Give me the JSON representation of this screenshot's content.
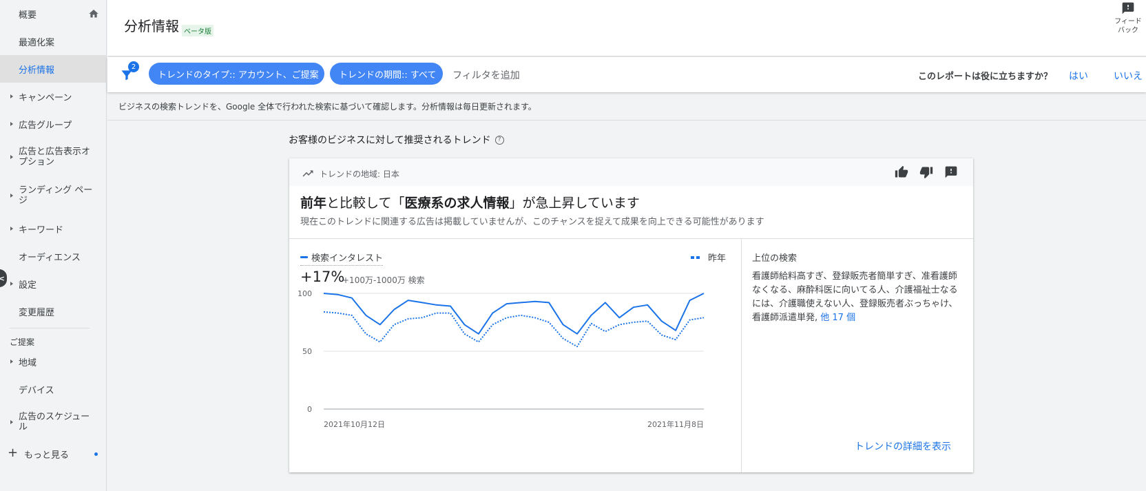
{
  "sidebar": {
    "items": [
      {
        "label": "概要",
        "caret": false
      },
      {
        "label": "最適化案",
        "caret": false
      },
      {
        "label": "分析情報",
        "caret": false,
        "active": true
      },
      {
        "label": "キャンペーン",
        "caret": true
      },
      {
        "label": "広告グループ",
        "caret": true
      },
      {
        "label": "広告と広告表示オプション",
        "caret": true
      },
      {
        "label": "ランディング ページ",
        "caret": true
      },
      {
        "label": "キーワード",
        "caret": true
      },
      {
        "label": "オーディエンス",
        "caret": false
      },
      {
        "label": "設定",
        "caret": true
      },
      {
        "label": "変更履歴",
        "caret": false
      }
    ],
    "section_label": "ご提案",
    "suggest_items": [
      {
        "label": "地域",
        "caret": true
      },
      {
        "label": "デバイス",
        "caret": false
      },
      {
        "label": "広告のスケジュール",
        "caret": true
      }
    ],
    "more_label": "もっと見る"
  },
  "header": {
    "title": "分析情報",
    "beta": "ベータ版",
    "feedback_label": "フィードバック"
  },
  "filterbar": {
    "filter_count": "2",
    "chip_type": "トレンドのタイプ:: アカウント、ご提案",
    "chip_period": "トレンドの期間:: すべて",
    "add_filter": "フィルタを追加",
    "question": "このレポートは役に立ちますか？",
    "yes": "はい",
    "no": "いいえ"
  },
  "info_text": "ビジネスの検索トレンドを、Google 全体で行われた検索に基づいて確認します。分析情報は毎日更新されます。",
  "section_title": "お客様のビジネスに対して推奨されるトレンド",
  "card": {
    "region": "トレンドの地域: 日本",
    "headline_pre": "前年",
    "headline_mid1": "と比較して「",
    "headline_bold": "医療系の求人情報",
    "headline_post": "」が急上昇しています",
    "subline": "現在このトレンドに関連する広告は掲載していませんが、このチャンスを捉えて成果を向上できる可能性があります",
    "legend_current": "検索インタレスト",
    "legend_prev": "昨年",
    "change_pct": "+17%",
    "change_sub": "+100万-1000万 検索",
    "top_searches_label": "上位の検索",
    "top_searches_text": "看護師給料高すぎ、登録販売者簡単すぎ、准看護師なくなる、麻酔科医に向いてる人、介護福祉士なるには、介護職使えない人、登録販売者ぶっちゃけ、看護師派遣単発, ",
    "more_link": "他 17 個",
    "detail_link": "トレンドの詳細を表示"
  },
  "chart_data": {
    "type": "line",
    "x_start_label": "2021年10月12日",
    "x_end_label": "2021年11月8日",
    "yticks": [
      "100",
      "50",
      "0"
    ],
    "ylim": [
      0,
      100
    ],
    "grid": true,
    "series": [
      {
        "name": "検索インタレスト",
        "style": "solid",
        "color": "#1a73e8",
        "values": [
          100,
          99,
          96,
          81,
          73,
          86,
          94,
          92,
          90,
          89,
          73,
          65,
          83,
          91,
          92,
          93,
          92,
          73,
          65,
          81,
          92,
          79,
          88,
          90,
          76,
          68,
          94,
          100
        ]
      },
      {
        "name": "昨年",
        "style": "dotted",
        "color": "#1a73e8",
        "values": [
          84,
          83,
          81,
          65,
          58,
          73,
          78,
          79,
          83,
          83,
          65,
          58,
          73,
          79,
          81,
          79,
          75,
          61,
          54,
          74,
          67,
          73,
          75,
          76,
          64,
          60,
          77,
          79
        ]
      }
    ]
  }
}
